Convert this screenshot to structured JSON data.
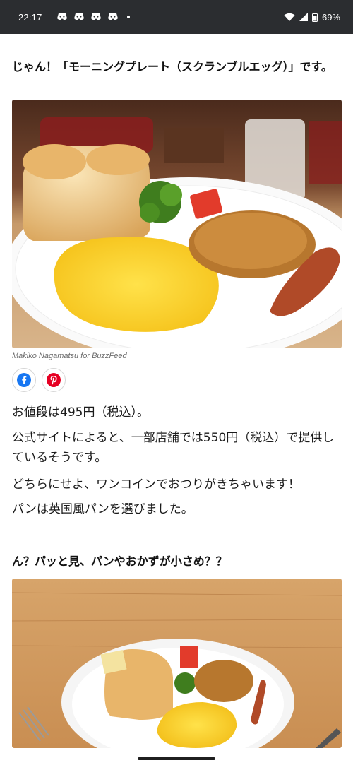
{
  "status_bar": {
    "time": "22:17",
    "notification_icons": [
      "discord-icon",
      "discord-icon",
      "discord-icon",
      "discord-icon"
    ],
    "battery_percent": "69%"
  },
  "article": {
    "heading_1": "じゃん！「モーニングプレート（スクランブルエッグ）」です。",
    "image_1_alt": "morning-plate-photo",
    "image_1_credit": "Makiko Nagamatsu for BuzzFeed",
    "share": {
      "facebook": "facebook-icon",
      "pinterest": "pinterest-icon"
    },
    "paragraphs": [
      "お値段は495円（税込）。",
      "公式サイトによると、一部店舗では550円（税込）で提供しているそうです。",
      "どちらにせよ、ワンコインでおつりがきちゃいます！",
      "パンは英国風パンを選びました。"
    ],
    "heading_2": "ん？パッと見、パンやおかずが小さめ？？",
    "image_2_alt": "plate-on-table-photo"
  },
  "colors": {
    "status_bar_bg": "#2b2d30",
    "facebook_blue": "#1877f2",
    "pinterest_red": "#e60023"
  }
}
